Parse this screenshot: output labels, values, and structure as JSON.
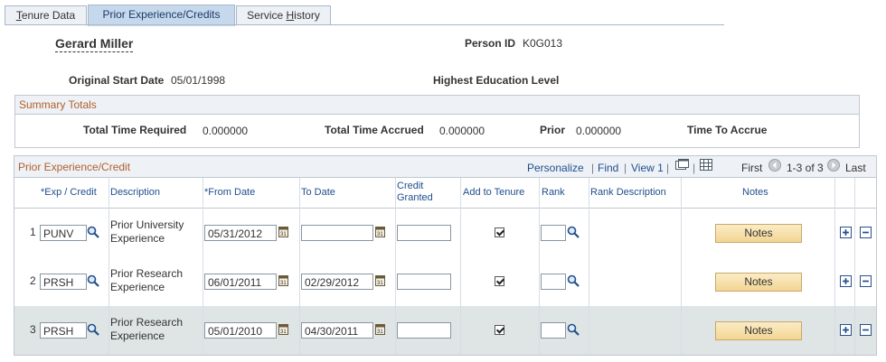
{
  "tabs": [
    {
      "label": "Tenure Data",
      "active": false
    },
    {
      "label": "Prior Experience/Credits",
      "active": true
    },
    {
      "label": "Service History",
      "active": false
    }
  ],
  "header": {
    "name": "Gerard Miller",
    "person_id_label": "Person ID",
    "person_id": "K0G013",
    "original_start_date_label": "Original Start Date",
    "original_start_date": "05/01/1998",
    "highest_education_label": "Highest Education Level"
  },
  "summary": {
    "title": "Summary Totals",
    "total_time_required_label": "Total Time Required",
    "total_time_required": "0.000000",
    "total_time_accrued_label": "Total Time Accrued",
    "total_time_accrued": "0.000000",
    "prior_label": "Prior",
    "prior": "0.000000",
    "time_to_accrue_label": "Time To Accrue"
  },
  "grid": {
    "title": "Prior Experience/Credit",
    "personalize": "Personalize",
    "find": "Find",
    "view": "View 1",
    "first": "First",
    "range": "1-3 of 3",
    "last": "Last",
    "columns": {
      "exp_credit": "*Exp / Credit",
      "description": "Description",
      "from_date": "*From Date",
      "to_date": "To Date",
      "credit_granted_1": "Credit",
      "credit_granted_2": "Granted",
      "add_to_tenure": "Add to Tenure",
      "rank": "Rank",
      "rank_description": "Rank Description",
      "notes": "Notes"
    },
    "rows": [
      {
        "num": "1",
        "code": "PUNV",
        "desc1": "Prior University",
        "desc2": "Experience",
        "from": "05/31/2012",
        "to": "",
        "credit": "",
        "add_to_tenure": true,
        "rank": "",
        "notes": "Notes"
      },
      {
        "num": "2",
        "code": "PRSH",
        "desc1": "Prior Research",
        "desc2": "Experience",
        "from": "06/01/2011",
        "to": "02/29/2012",
        "credit": "",
        "add_to_tenure": true,
        "rank": "",
        "notes": "Notes"
      },
      {
        "num": "3",
        "code": "PRSH",
        "desc1": "Prior Research",
        "desc2": "Experience",
        "from": "05/01/2010",
        "to": "04/30/2011",
        "credit": "",
        "add_to_tenure": true,
        "rank": "",
        "notes": "Notes"
      }
    ]
  },
  "colors": {
    "section_title": "#b25e2c",
    "link": "#1f4e8c",
    "notes_button": "#f7e0a4",
    "selected_row": "#dfe4e4"
  }
}
